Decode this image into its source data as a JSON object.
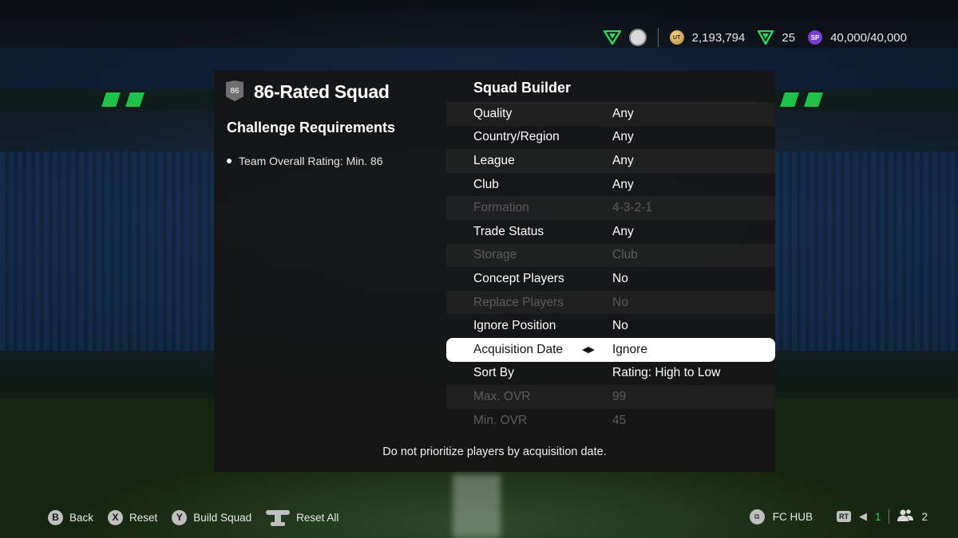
{
  "topbar": {
    "coins": "2,193,794",
    "fc_points": "25",
    "sp_value": "40,000/40,000",
    "coin_icon_text": "UT",
    "sp_icon_text": "SP"
  },
  "left_panel": {
    "rating_badge": "86",
    "title": "86-Rated Squad",
    "requirements_title": "Challenge Requirements",
    "requirements": [
      "Team Overall Rating: Min. 86"
    ]
  },
  "builder": {
    "title": "Squad Builder",
    "rows": [
      {
        "label": "Quality",
        "value": "Any",
        "state": "enabled"
      },
      {
        "label": "Country/Region",
        "value": "Any",
        "state": "enabled"
      },
      {
        "label": "League",
        "value": "Any",
        "state": "enabled"
      },
      {
        "label": "Club",
        "value": "Any",
        "state": "enabled"
      },
      {
        "label": "Formation",
        "value": "4-3-2-1",
        "state": "disabled"
      },
      {
        "label": "Trade Status",
        "value": "Any",
        "state": "enabled"
      },
      {
        "label": "Storage",
        "value": "Club",
        "state": "disabled"
      },
      {
        "label": "Concept Players",
        "value": "No",
        "state": "enabled"
      },
      {
        "label": "Replace Players",
        "value": "No",
        "state": "disabled"
      },
      {
        "label": "Ignore Position",
        "value": "No",
        "state": "enabled"
      },
      {
        "label": "Acquisition Date",
        "value": "Ignore",
        "state": "selected"
      },
      {
        "label": "Sort By",
        "value": "Rating: High to Low",
        "state": "enabled"
      },
      {
        "label": "Max. OVR",
        "value": "99",
        "state": "disabled"
      },
      {
        "label": "Min. OVR",
        "value": "45",
        "state": "disabled"
      }
    ],
    "arrows": "◀▶",
    "description": "Do not prioritize players by acquisition date."
  },
  "bottom_bar": {
    "buttons": [
      {
        "key": "B",
        "label": "Back"
      },
      {
        "key": "X",
        "label": "Reset"
      },
      {
        "key": "Y",
        "label": "Build Squad"
      }
    ],
    "reset_all_label": "Reset All",
    "hub_label": "FC HUB",
    "rt_label": "RT",
    "voice_count": "1",
    "friends_count": "2"
  },
  "colors": {
    "accent_green": "#2fd45c",
    "selected_row_bg": "#ffffff",
    "panel_bg": "#161616",
    "sp_purple": "#7a3fd0"
  },
  "icons": {
    "topbar": [
      "fc-green-logo-icon",
      "club-badge-icon",
      "coins-icon",
      "fc-points-icon",
      "sp-icon"
    ],
    "bottom": [
      "left-stick-icon",
      "fc-hub-icon",
      "mic-muted-icon",
      "friends-icon"
    ]
  }
}
